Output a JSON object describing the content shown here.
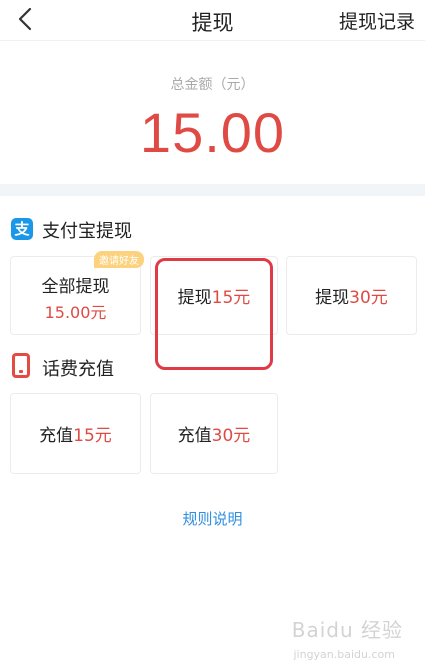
{
  "header": {
    "title": "提现",
    "records_link": "提现记录"
  },
  "summary": {
    "label": "总金额（元）",
    "amount": "15.00"
  },
  "alipay": {
    "section_title": "支付宝提现",
    "icon_glyph": "支",
    "all": {
      "label": "全部提现",
      "amount": "15.00元",
      "badge": "邀请好友"
    },
    "option_15": {
      "prefix": "提现",
      "amount": "15元"
    },
    "option_30": {
      "prefix": "提现",
      "amount": "30元"
    }
  },
  "phone_recharge": {
    "section_title": "话费充值",
    "option_15": {
      "prefix": "充值",
      "amount": "15元"
    },
    "option_30": {
      "prefix": "充值",
      "amount": "30元"
    }
  },
  "rules_link": "规则说明",
  "watermark": {
    "text": "Baidu 经验",
    "sub": "jingyan.baidu.com"
  },
  "colors": {
    "accent_red": "#e04a44",
    "link_blue": "#2f8fe0",
    "alipay_blue": "#1a97e8",
    "highlight_red": "#e03a47"
  }
}
